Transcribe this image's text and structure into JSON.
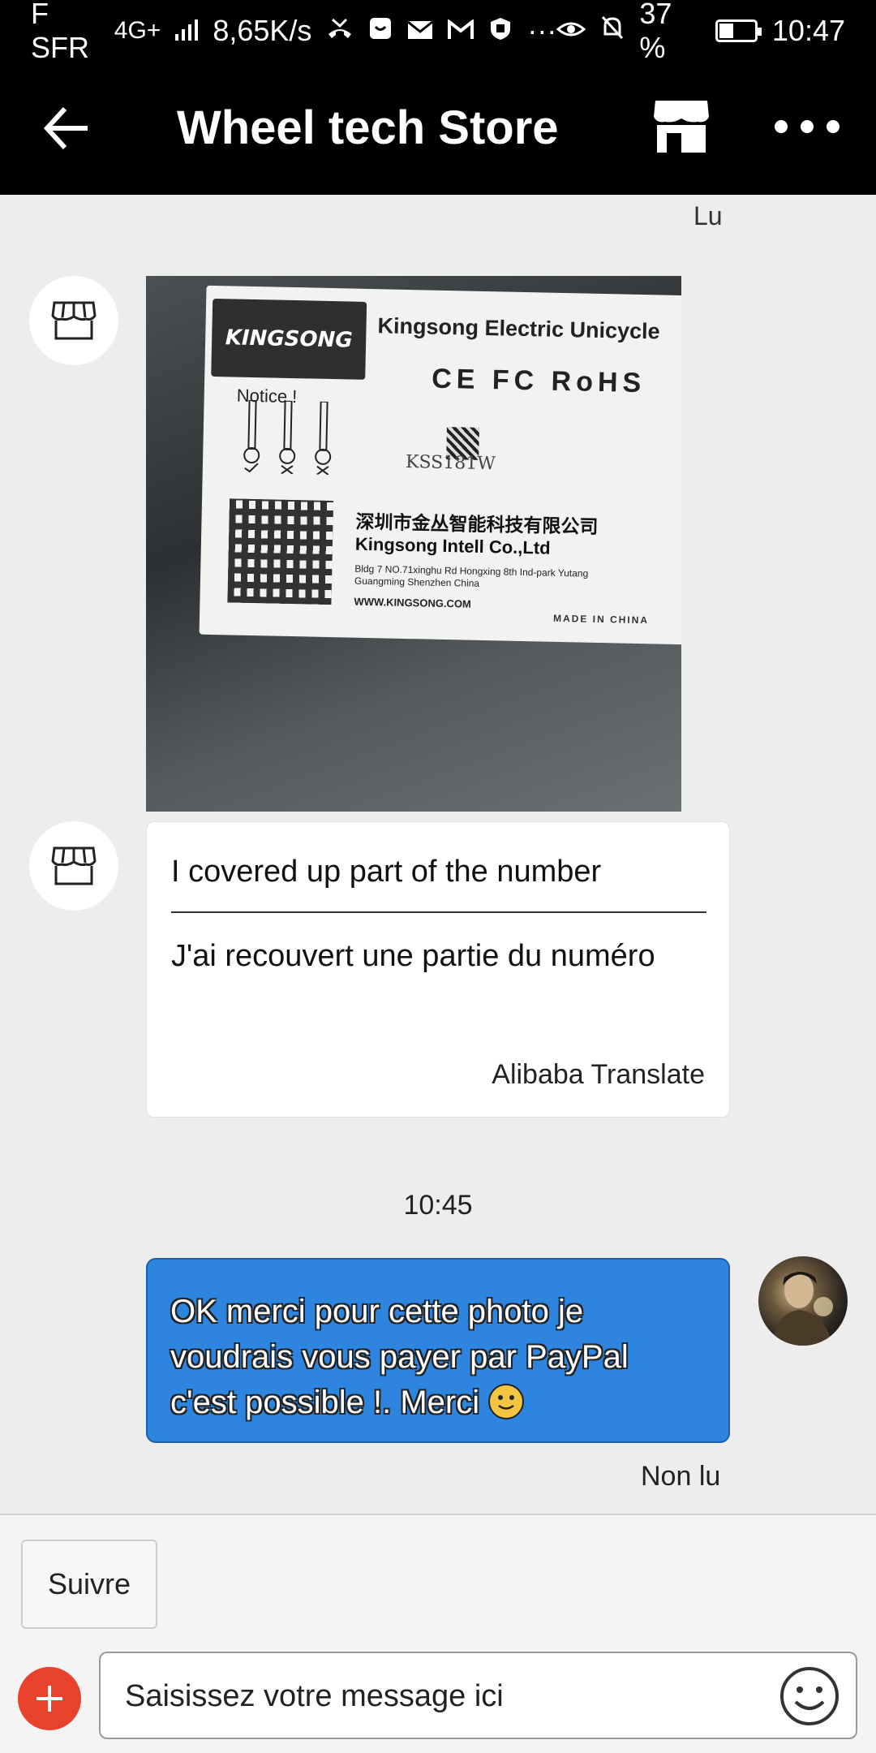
{
  "status_bar": {
    "carrier": "F SFR",
    "network": "4G+",
    "speed": "8,65K/s",
    "battery": "37 %",
    "battery_level": 0.37,
    "time": "10:47"
  },
  "header": {
    "title": "Wheel tech Store",
    "icons": [
      "back-arrow-icon",
      "store-icon",
      "more-icon"
    ]
  },
  "chat": {
    "read_status_top": "Lu",
    "photo_label": {
      "logo": "KINGSONG",
      "title": "Kingsong Electric Unicycle",
      "certs": "CE FC RoHS",
      "notice": "Notice !",
      "serial": "KSS181W",
      "company_cn": "深圳市金丛智能科技有限公司",
      "company_en": "Kingsong Intell Co.,Ltd",
      "address": "Bldg 7 NO.71xinghu Rd Hongxing 8th Ind-park Yutang Guangming Shenzhen China",
      "website": "WWW.KINGSONG.COM",
      "made_in": "MADE IN CHINA"
    },
    "incoming_message": {
      "original": "I covered up part of the number",
      "translated": "J'ai recouvert une partie du numéro",
      "translator": "Alibaba Translate"
    },
    "timestamp": "10:45",
    "outgoing_message": {
      "text": "OK merci pour cette photo je voudrais vous payer par PayPal c'est possible !. Merci",
      "emoji": "slightly-smiling-face"
    },
    "unread_status": "Non lu"
  },
  "bottom": {
    "follow_label": "Suivre",
    "input_placeholder": "Saisissez votre message ici"
  },
  "colors": {
    "outgoing_bubble": "#2d85e0",
    "plus_button": "#e8412c",
    "header_bg": "#000000",
    "chat_bg": "#ededed"
  }
}
